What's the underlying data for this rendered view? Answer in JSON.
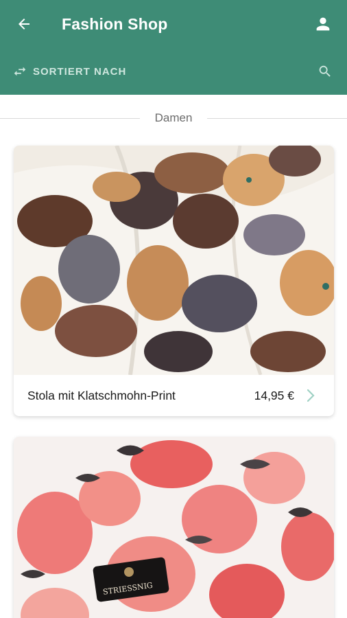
{
  "header": {
    "title": "Fashion Shop",
    "sort_label": "SORTIERT NACH",
    "back_icon": "arrow-left-icon",
    "user_icon": "person-icon",
    "sort_icon": "swap-arrows-icon",
    "search_icon": "search-icon",
    "color": "#3e8c76"
  },
  "section": {
    "title": "Damen"
  },
  "products": [
    {
      "name": "Stola mit Klatschmohn-Print",
      "price": "14,95 €",
      "image": "scarf-poppy-print-image"
    },
    {
      "name": "",
      "price": "",
      "image": "scarf-red-rose-print-image",
      "logo_text": "STRIESSNIG"
    }
  ]
}
